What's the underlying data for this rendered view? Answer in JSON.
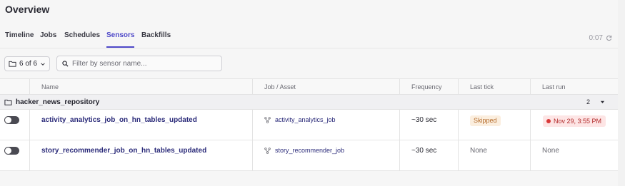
{
  "page": {
    "title": "Overview"
  },
  "tabs": [
    {
      "label": "Timeline",
      "active": false
    },
    {
      "label": "Jobs",
      "active": false
    },
    {
      "label": "Schedules",
      "active": false
    },
    {
      "label": "Sensors",
      "active": true
    },
    {
      "label": "Backfills",
      "active": false
    }
  ],
  "refresh": {
    "timer": "0:07",
    "icon": "refresh-icon"
  },
  "filters": {
    "repo_select_label": "6 of 6",
    "search_placeholder": "Filter by sensor name..."
  },
  "table": {
    "columns": [
      "Name",
      "Job / Asset",
      "Frequency",
      "Last tick",
      "Last run"
    ],
    "group": {
      "name": "hacker_news_repository",
      "count": "2"
    },
    "rows": [
      {
        "name": "activity_analytics_job_on_hn_tables_updated",
        "job": "activity_analytics_job",
        "frequency": "~30 sec",
        "last_tick": "Skipped",
        "last_run": "Nov 29, 3:55 PM"
      },
      {
        "name": "story_recommender_job_on_hn_tables_updated",
        "job": "story_recommender_job",
        "frequency": "~30 sec",
        "last_tick": "None",
        "last_run": "None"
      }
    ]
  },
  "colors": {
    "accent": "#4e48c8",
    "link": "#2c2c7a",
    "skipped_bg": "#fbeede",
    "failure_bg": "#fde5e5",
    "failure_dot": "#d93838"
  }
}
